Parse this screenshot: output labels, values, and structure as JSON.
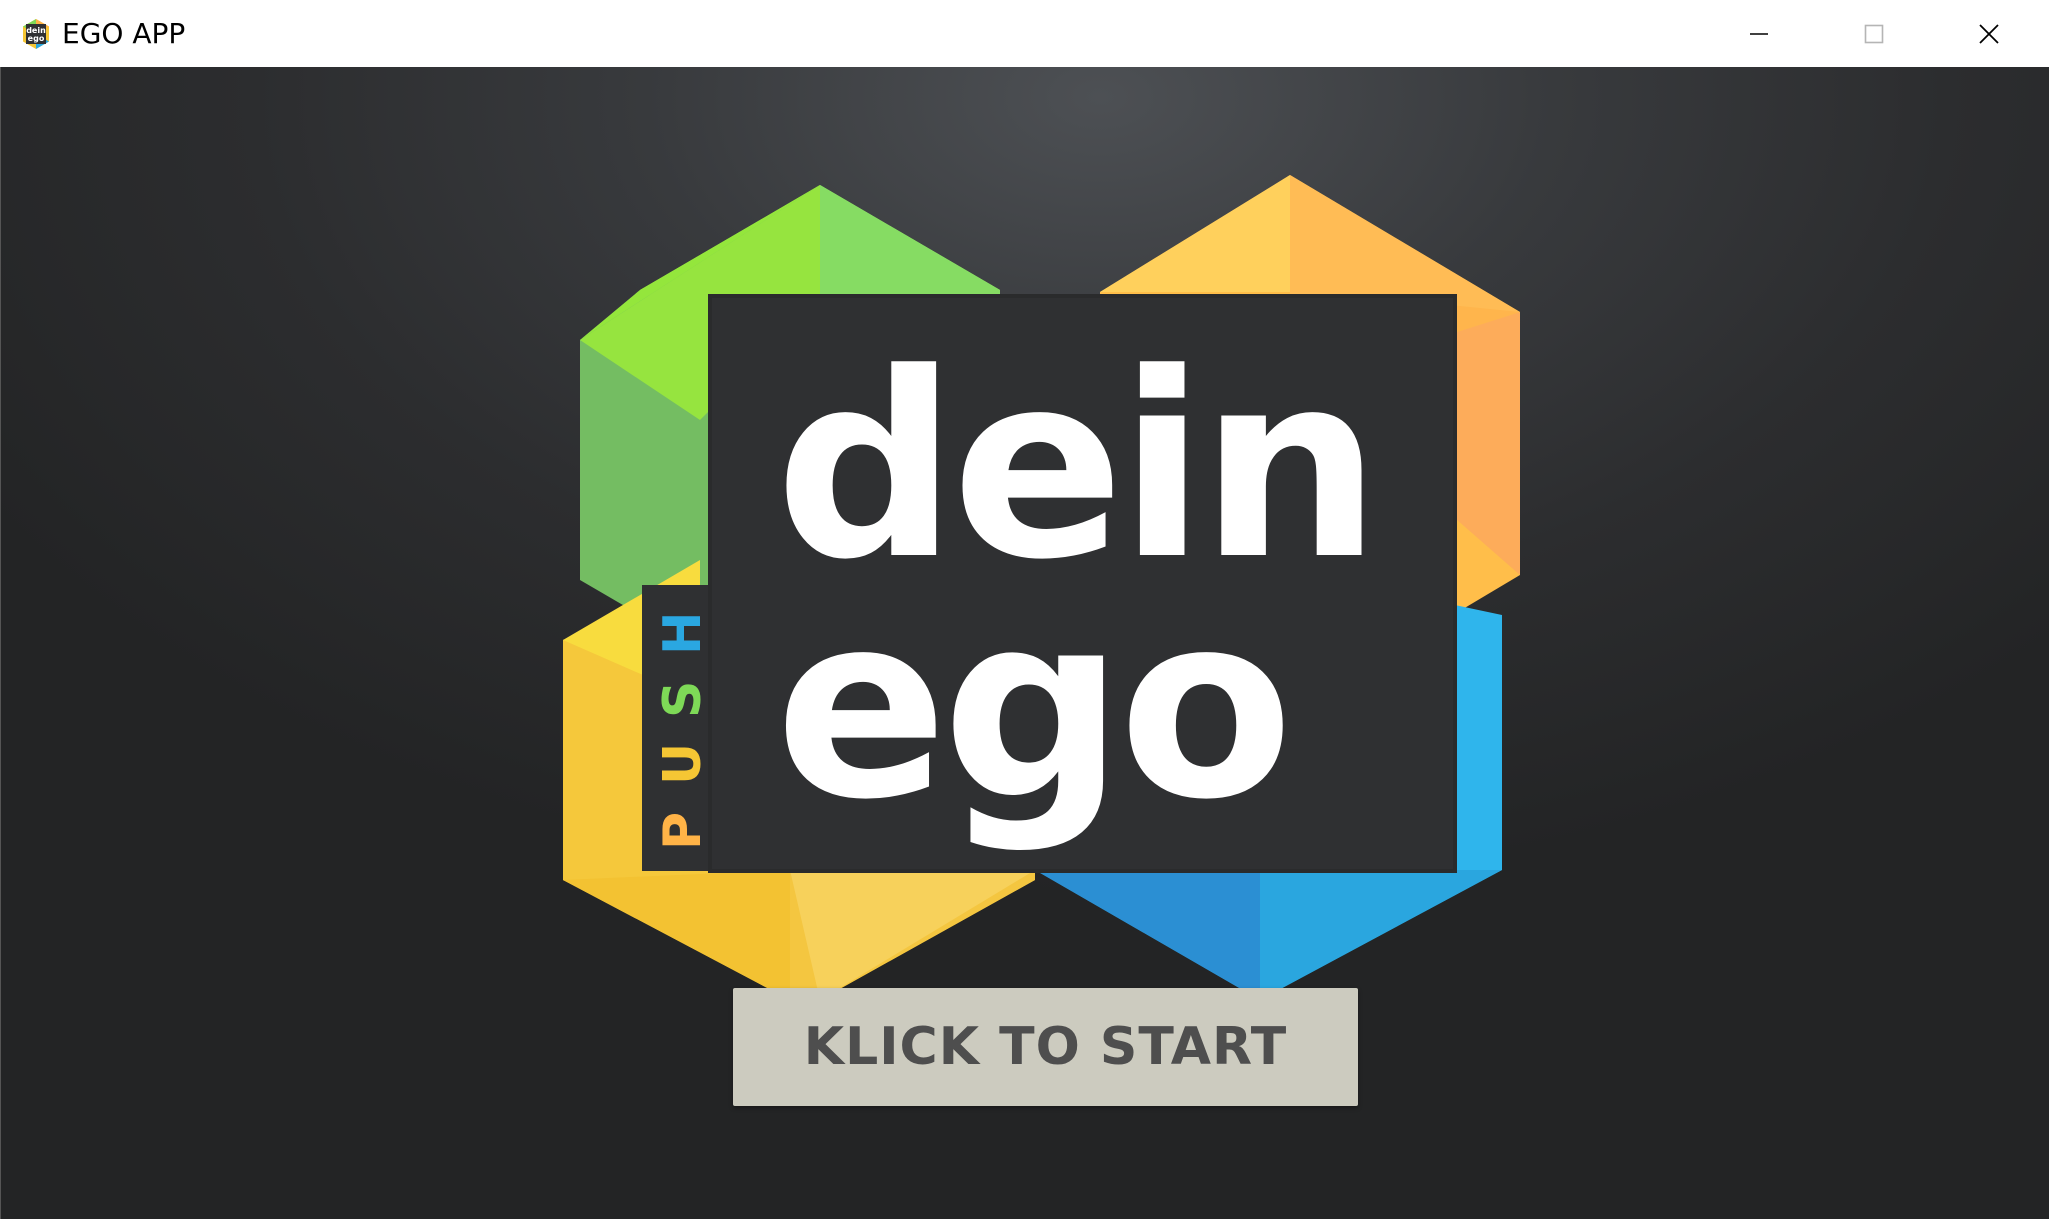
{
  "window": {
    "title": "EGO APP",
    "app_icon": "dein-ego-app-icon",
    "app_icon_text_top": "dein",
    "app_icon_text_bottom": "ego",
    "controls": {
      "minimize_icon": "minimize-icon",
      "maximize_icon": "maximize-icon",
      "close_icon": "close-icon"
    }
  },
  "logo": {
    "word_top": "dein",
    "word_bottom": "ego",
    "vertical_letters": [
      "P",
      "U",
      "S",
      "H"
    ],
    "colors": {
      "green": "#7ed957",
      "orange": "#ffb347",
      "yellow": "#f5c634",
      "blue": "#2aa7e1",
      "box": "#2f3032",
      "text": "#ffffff"
    }
  },
  "start_button": {
    "label": "KLICK TO START"
  }
}
